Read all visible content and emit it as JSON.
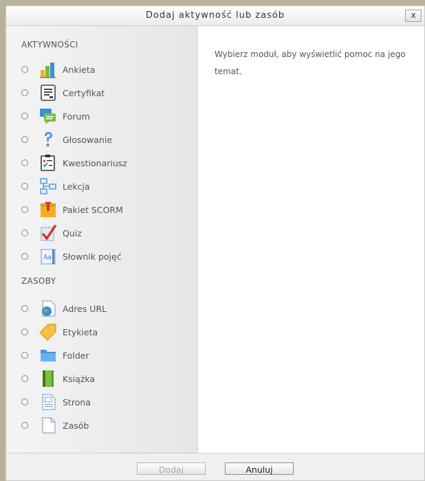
{
  "dialog": {
    "title": "Dodaj aktywność lub zasób",
    "close_label": "x",
    "help_text": "Wybierz moduł, aby wyświetlić pomoc na jego temat."
  },
  "activities": {
    "heading": "AKTYWNOŚCI",
    "items": [
      {
        "label": "Ankieta",
        "icon": "survey-bar-chart-icon"
      },
      {
        "label": "Certyfikat",
        "icon": "certificate-icon"
      },
      {
        "label": "Forum",
        "icon": "forum-chat-icon"
      },
      {
        "label": "Głosowanie",
        "icon": "choice-question-icon"
      },
      {
        "label": "Kwestionariusz",
        "icon": "questionnaire-checklist-icon"
      },
      {
        "label": "Lekcja",
        "icon": "lesson-flowchart-icon"
      },
      {
        "label": "Pakiet SCORM",
        "icon": "scorm-package-icon"
      },
      {
        "label": "Quiz",
        "icon": "quiz-checkmark-icon"
      },
      {
        "label": "Słownik pojęć",
        "icon": "glossary-book-icon"
      }
    ]
  },
  "resources": {
    "heading": "ZASOBY",
    "items": [
      {
        "label": "Adres URL",
        "icon": "url-globe-icon"
      },
      {
        "label": "Etykieta",
        "icon": "label-tag-icon"
      },
      {
        "label": "Folder",
        "icon": "folder-icon"
      },
      {
        "label": "Książka",
        "icon": "book-icon"
      },
      {
        "label": "Strona",
        "icon": "page-icon"
      },
      {
        "label": "Zasób",
        "icon": "file-icon"
      }
    ]
  },
  "footer": {
    "add_label": "Dodaj",
    "cancel_label": "Anuluj"
  }
}
